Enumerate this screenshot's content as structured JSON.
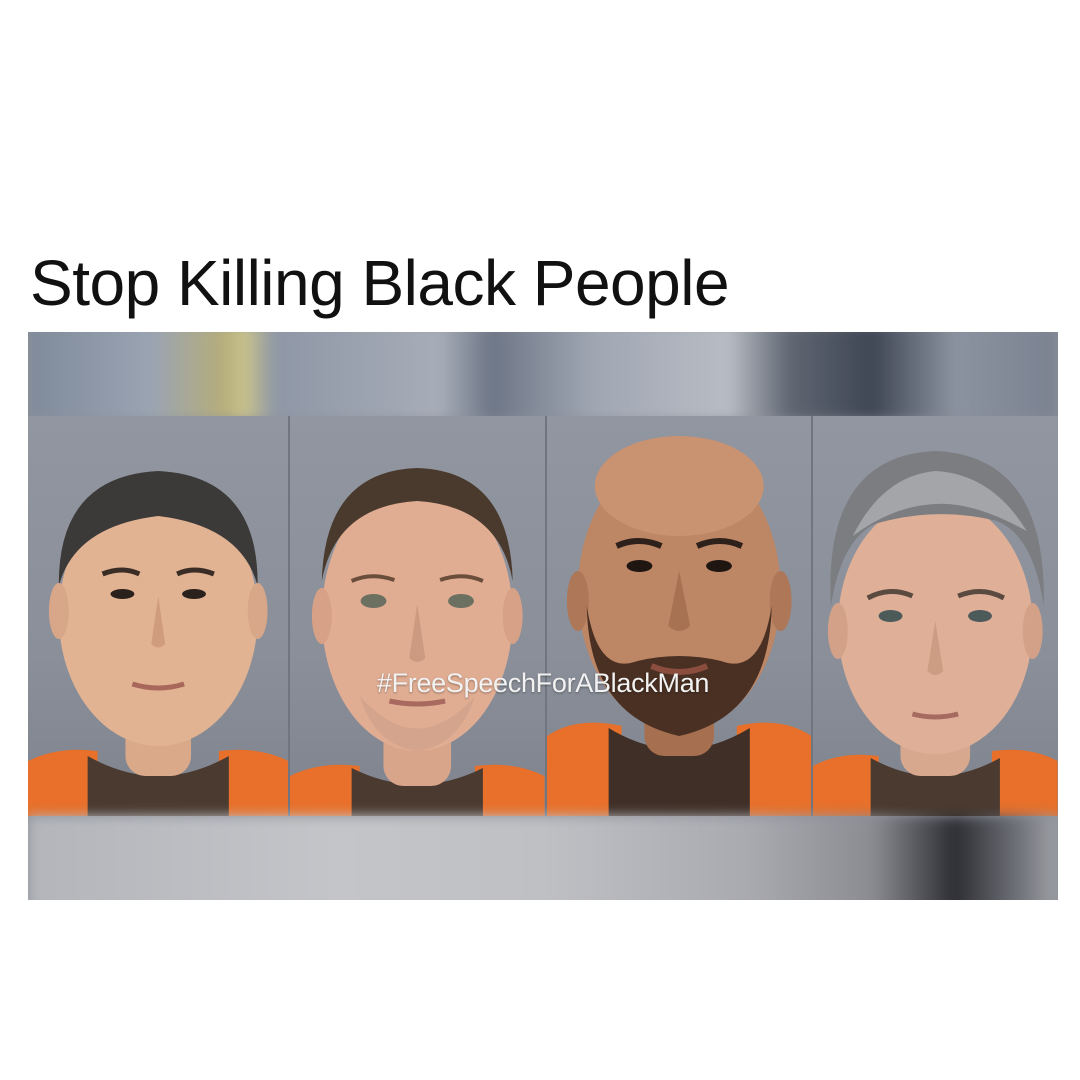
{
  "headline": "Stop Killing Black People",
  "overlay_text": "#FreeSpeechForABlackMan",
  "colors": {
    "background": "#ffffff",
    "headline_text": "#111111",
    "photo_backdrop": "#8e9299",
    "jumpsuit_orange": "#e8702a",
    "overlay_text": "#f2f2f2"
  },
  "photos": [
    {
      "name": "mugshot-1"
    },
    {
      "name": "mugshot-2"
    },
    {
      "name": "mugshot-3"
    },
    {
      "name": "mugshot-4"
    }
  ]
}
